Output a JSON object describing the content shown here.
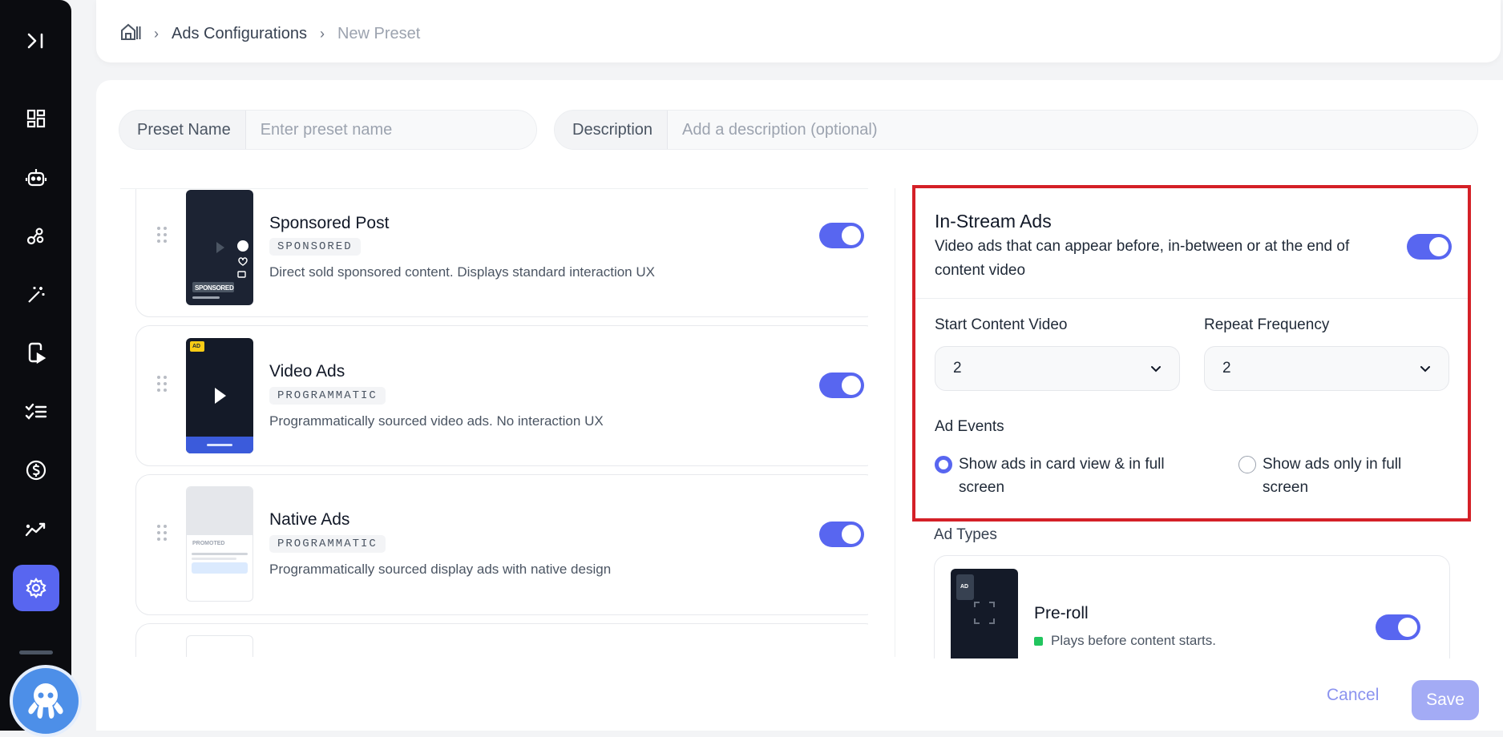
{
  "sidebar": {
    "toggle_icon": "collapse-sidebar-icon",
    "items": [
      {
        "icon": "dashboard-icon"
      },
      {
        "icon": "robot-icon"
      },
      {
        "icon": "analytics-nodes-icon"
      },
      {
        "icon": "magic-wand-icon"
      },
      {
        "icon": "mobile-video-icon"
      },
      {
        "icon": "checklist-icon"
      },
      {
        "icon": "dollar-icon"
      },
      {
        "icon": "trending-icon"
      },
      {
        "icon": "settings-icon",
        "active": true
      }
    ],
    "avatar_icon": "octopus-icon"
  },
  "breadcrumb": {
    "home_icon": "home-icon",
    "items": [
      "Ads Configurations",
      "New Preset"
    ]
  },
  "form": {
    "preset_name_label": "Preset Name",
    "preset_name_placeholder": "Enter preset name",
    "description_label": "Description",
    "description_placeholder": "Add a description (optional)"
  },
  "ad_formats": [
    {
      "title": "Sponsored Post",
      "badge": "SPONSORED",
      "description": "Direct sold sponsored content. Displays standard interaction UX",
      "thumb_tag": "SPONSORED",
      "enabled": true
    },
    {
      "title": "Video Ads",
      "badge": "PROGRAMMATIC",
      "description": "Programmatically sourced video ads. No interaction UX",
      "thumb_tag": "AD",
      "enabled": true
    },
    {
      "title": "Native Ads",
      "badge": "PROGRAMMATIC",
      "description": "Programmatically sourced display ads with native design",
      "thumb_tag": "PROMOTED",
      "enabled": true
    }
  ],
  "instream": {
    "title": "In-Stream Ads",
    "description": "Video ads that can appear before, in-between or at the end of content video",
    "enabled": true,
    "start_label": "Start Content Video",
    "start_value": "2",
    "repeat_label": "Repeat Frequency",
    "repeat_value": "2",
    "events_label": "Ad Events",
    "event_options": [
      {
        "label": "Show ads in card view & in full screen",
        "selected": true
      },
      {
        "label": "Show ads only in full screen",
        "selected": false
      }
    ]
  },
  "ad_types": {
    "label": "Ad Types",
    "items": [
      {
        "title": "Pre-roll",
        "description": "Plays before content starts.",
        "thumb_tag": "AD",
        "status_color": "#22c55e",
        "enabled": true
      }
    ]
  },
  "footer": {
    "cancel_label": "Cancel",
    "save_label": "Save"
  },
  "colors": {
    "accent": "#5866f0",
    "highlight_border": "#d42027",
    "sidebar_bg": "#0b0c10"
  }
}
